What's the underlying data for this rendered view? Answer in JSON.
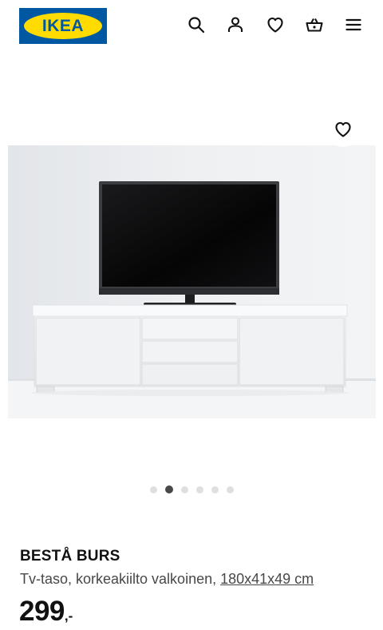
{
  "brand": {
    "logo_text": "IKEA",
    "colors": {
      "blue": "#0058a3",
      "yellow": "#ffdb00"
    }
  },
  "header": {
    "icons": [
      "search-icon",
      "profile-icon",
      "heart-icon",
      "basket-icon",
      "menu-icon"
    ]
  },
  "gallery": {
    "image": "tv-bench-with-television",
    "favourite_icon": "heart-icon",
    "slide_count": 6,
    "active_slide": 2
  },
  "product": {
    "name": "BESTÅ BURS",
    "description": "Tv-taso, korkeakiilto valkoinen, ",
    "measurement": "180x41x49 cm",
    "price_integer": "299",
    "price_suffix": ",-"
  }
}
